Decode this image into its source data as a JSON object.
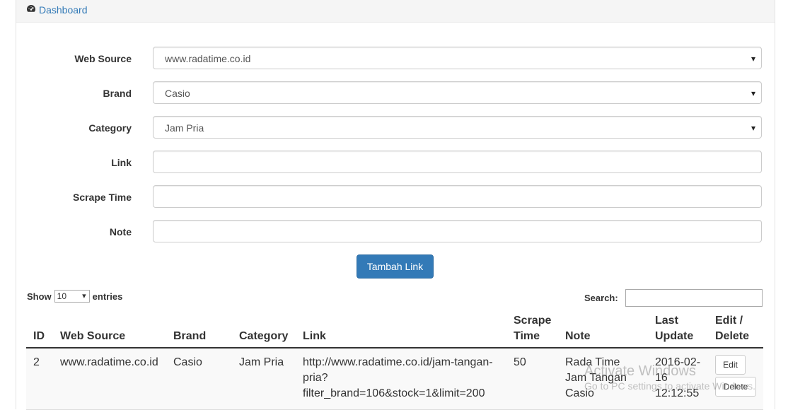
{
  "breadcrumb": {
    "label": "Dashboard",
    "icon": "dashboard-icon"
  },
  "form": {
    "web_source": {
      "label": "Web Source",
      "value": "www.radatime.co.id"
    },
    "brand": {
      "label": "Brand",
      "value": "Casio"
    },
    "category": {
      "label": "Category",
      "value": "Jam Pria"
    },
    "link": {
      "label": "Link",
      "value": ""
    },
    "scrape_time": {
      "label": "Scrape Time",
      "value": ""
    },
    "note": {
      "label": "Note",
      "value": ""
    },
    "submit_label": "Tambah Link"
  },
  "table_controls": {
    "show_label": "Show",
    "entries_value": "10",
    "entries_label": "entries",
    "search_label": "Search:"
  },
  "table": {
    "headers": {
      "id": "ID",
      "web_source": "Web Source",
      "brand": "Brand",
      "category": "Category",
      "link": "Link",
      "scrape_time_1": "Scrape",
      "scrape_time_2": "Time",
      "note": "Note",
      "last_update_1": "Last",
      "last_update_2": "Update",
      "edit_delete_1": "Edit /",
      "edit_delete_2": "Delete"
    },
    "rows": [
      {
        "id": "2",
        "web_source": "www.radatime.co.id",
        "brand": "Casio",
        "category": "Jam Pria",
        "link_line1": "http://www.radatime.co.id/jam-tangan-",
        "link_line2": "pria?",
        "link_line3": "filter_brand=106&stock=1&limit=200",
        "scrape_time": "50",
        "note_line1": "Rada Time",
        "note_line2": "Jam Tangan",
        "note_line3": "Casio",
        "last_update_line1": "2016-02-",
        "last_update_line2": "16",
        "last_update_line3": "12:12:55",
        "edit_label": "Edit",
        "delete_label": "Delete"
      }
    ]
  },
  "watermark": {
    "line1": "Activate Windows",
    "line2": "Go to PC settings to activate Windows."
  },
  "colors": {
    "primary": "#337ab7",
    "link": "#337ab7"
  }
}
